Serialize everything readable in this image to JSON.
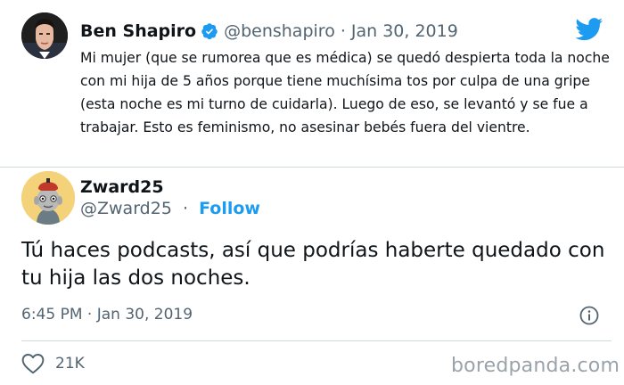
{
  "quoted_tweet": {
    "display_name": "Ben Shapiro",
    "handle": "@benshapiro",
    "separator": "·",
    "date": "Jan 30, 2019",
    "text": "Mi mujer (que se rumorea que es médica) se quedó despierta toda la noche con mi hija de 5 años porque tiene muchísima tos por culpa de una gripe (esta noche es mi turno de cuidarla). Luego de eso, se levantó y se fue a trabajar. Esto es feminismo, no asesinar bebés fuera del vientre.",
    "verified_icon": "verified-badge-icon",
    "platform_icon": "twitter-bird-icon"
  },
  "main_tweet": {
    "display_name": "Zward25",
    "handle": "@Zward25",
    "separator": "·",
    "follow_label": "Follow",
    "text": "Tú haces podcasts, así que podrías haberte quedado con tu hija las dos noches.",
    "time": "6:45 PM · Jan 30, 2019",
    "info_icon": "info-icon"
  },
  "actions": {
    "like_icon": "heart-icon",
    "like_count": "21K"
  },
  "watermark": "boredpanda.com",
  "colors": {
    "twitter_blue": "#1d9bf0",
    "text_primary": "#0f1419",
    "text_secondary": "#536471",
    "divider": "#cfd9de"
  }
}
